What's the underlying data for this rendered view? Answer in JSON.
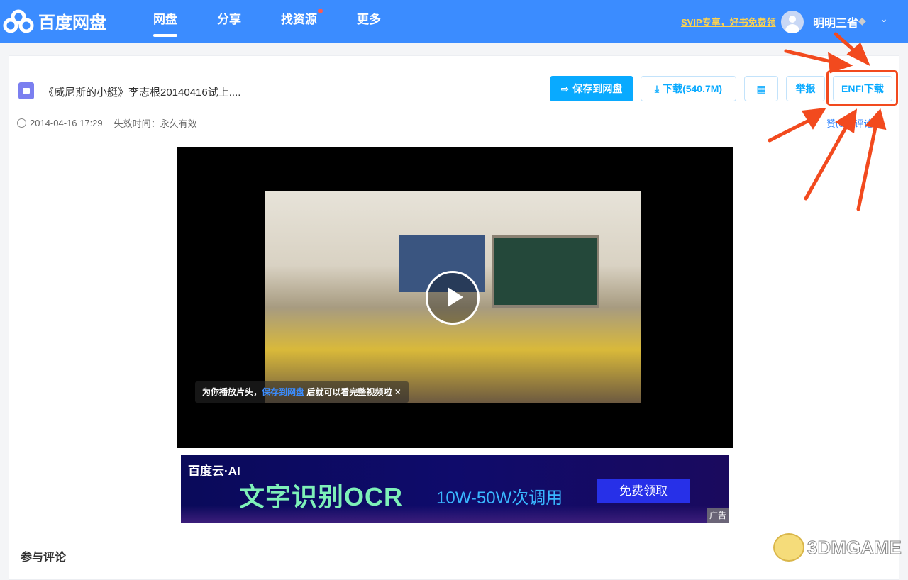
{
  "header": {
    "logo": "百度网盘",
    "nav": [
      {
        "label": "网盘",
        "active": true
      },
      {
        "label": "分享"
      },
      {
        "label": "找资源",
        "badge_dot": true
      },
      {
        "label": "更多"
      }
    ],
    "promo": "SVIP专享，好书免费领",
    "username": "明明三省",
    "vip_icon": "diamond-icon",
    "accent": "#3b8cff"
  },
  "file": {
    "title": "《威尼斯的小艇》李志根20140416试上....",
    "date": "2014-04-16 17:29",
    "expiry": "失效时间：永久有效",
    "icon": "video-file-icon"
  },
  "actions": {
    "save": "保存到网盘",
    "download": "下载(540.7M)",
    "qrcode": "qrcode-icon",
    "report": "举报",
    "enfi": "ENFI下载",
    "like": "赞(0)",
    "comment": "评论(0)"
  },
  "player": {
    "tip_prefix": "为你播放片头，",
    "tip_link": "保存到网盘",
    "tip_suffix": " 后就可以看完整视频啦"
  },
  "ad": {
    "brand": "百度云·AI",
    "main": "文字识别OCR",
    "sub": "10W-50W次调用",
    "button": "免费领取",
    "tag": "广告"
  },
  "comments": {
    "title": "参与评论"
  },
  "watermark": "3DMGAME"
}
